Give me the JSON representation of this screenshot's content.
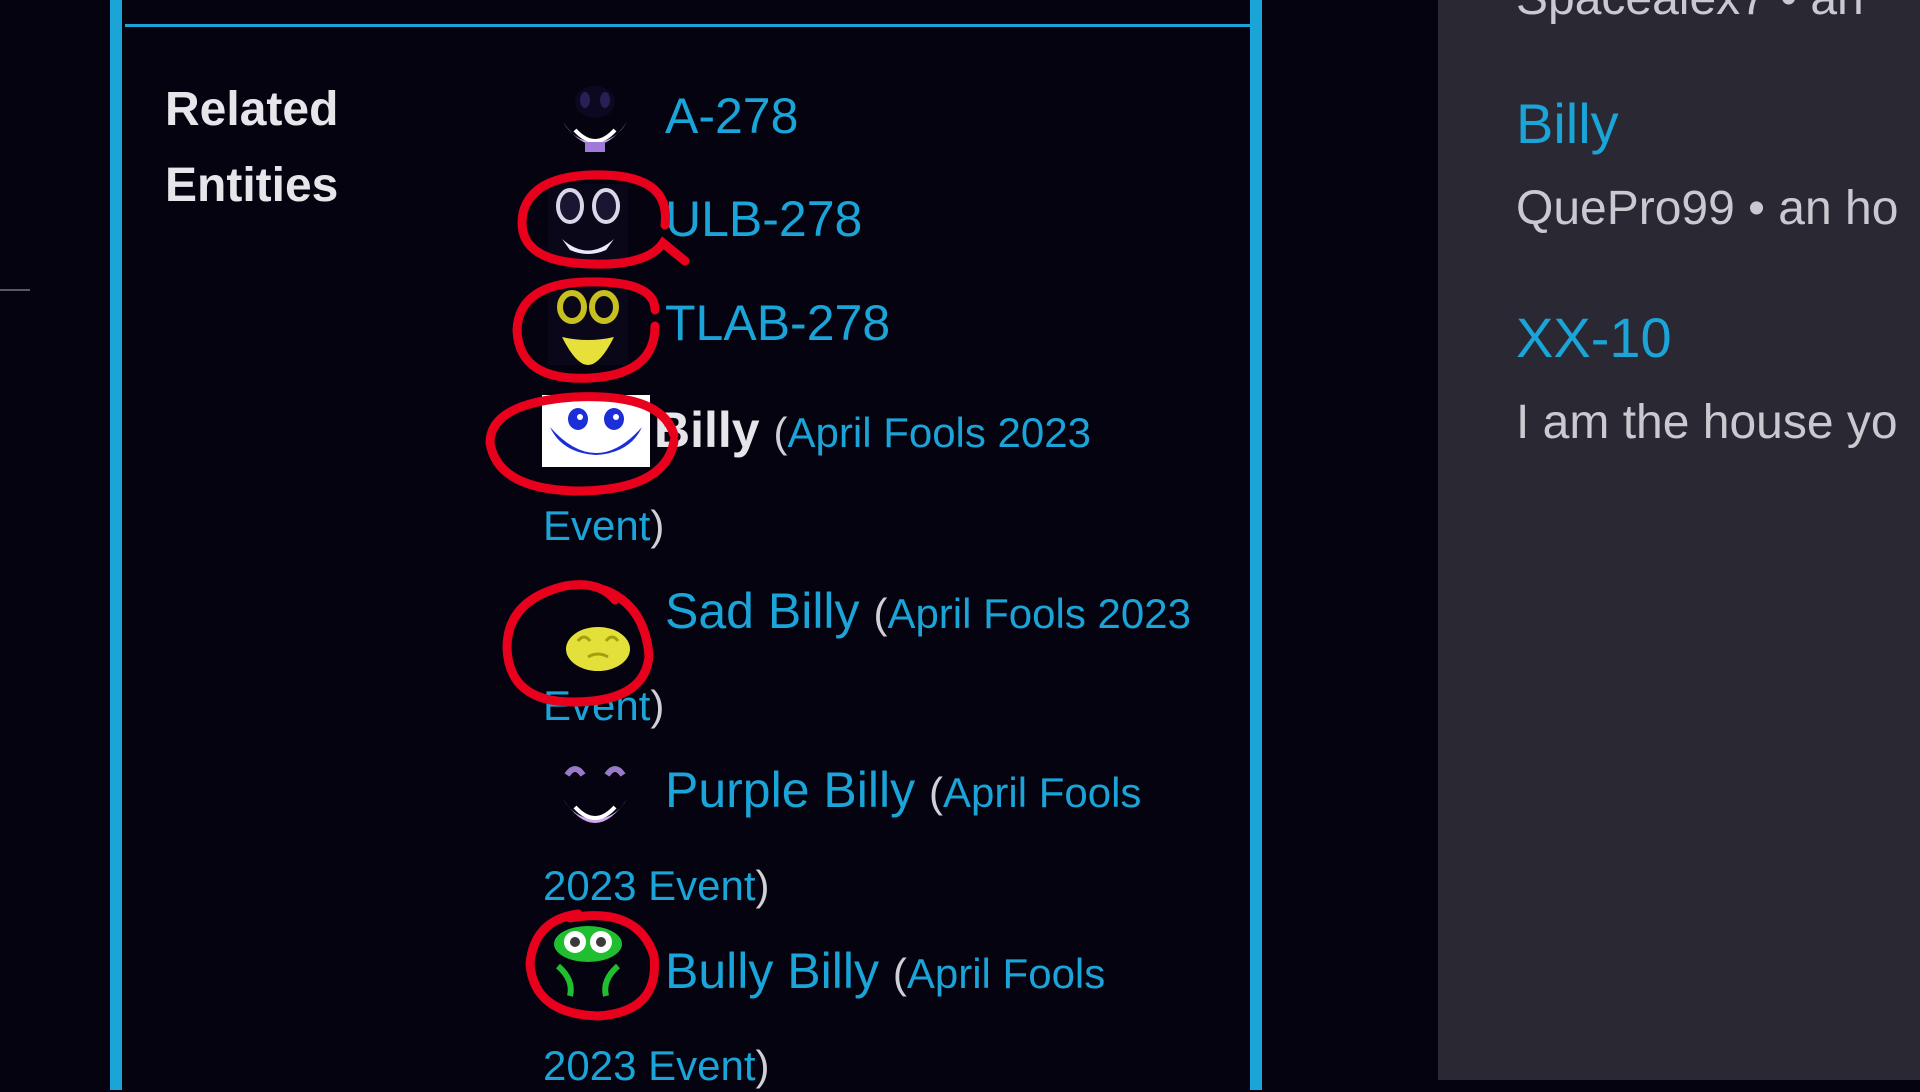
{
  "infobox": {
    "row_label_line1": "Related",
    "row_label_line2": "Entities",
    "entries": [
      {
        "name": "A-278",
        "icon": "purple-grin-face-icon"
      },
      {
        "name": "ULB-278",
        "icon": "dark-grin-face-icon"
      },
      {
        "name": "TLAB-278",
        "icon": "yellow-eyes-face-icon"
      },
      {
        "name": "Billy",
        "event": "April Fools 2023",
        "event_cont": "Event",
        "icon": "blue-smile-face-icon"
      },
      {
        "name": "Sad Billy",
        "event": "April Fools 2023",
        "event_cont": "Event",
        "icon": "yellow-blob-face-icon"
      },
      {
        "name": "Purple Billy",
        "event": "April Fools",
        "event_cont": "2023 Event",
        "icon": "purple-billy-face-icon"
      },
      {
        "name": "Bully Billy",
        "event": "April Fools",
        "event_cont": "2023 Event",
        "icon": "green-bully-face-icon"
      }
    ]
  },
  "right_panel": {
    "cut_top": "Spacealex7 • an",
    "items": [
      {
        "title": "Billy",
        "subtitle": "QuePro99 • an ho"
      },
      {
        "title": "XX-10",
        "subtitle": "I am the house yo"
      }
    ]
  },
  "colors": {
    "accent": "#1aa4d8",
    "background": "#050310",
    "panel": "#2a2833",
    "annotation": "#e8001c"
  }
}
